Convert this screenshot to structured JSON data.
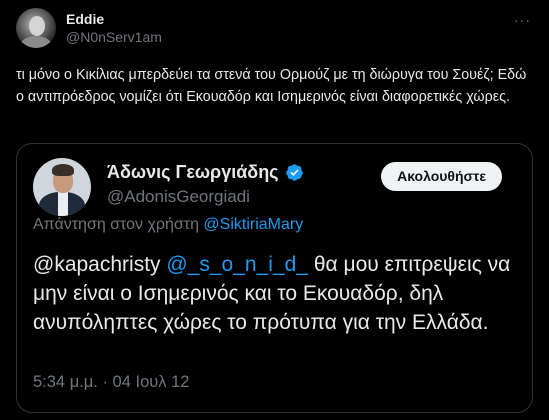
{
  "post": {
    "display_name": "Eddie",
    "handle": "@N0nServ1am",
    "more_label": "···",
    "text": "τι μόνο ο Κικίλιας μπερδεύει τα στενά του Ορμούζ με τη διώρυγα του Σουέζ; Εδώ ο αντιπρόεδρος νομίζει ότι Εκουαδόρ και Ισημερινός είναι διαφορετικές χώρες."
  },
  "quoted": {
    "display_name": "Άδωνις Γεωργιάδης",
    "handle": "@AdonisGeorgiadi",
    "verified": true,
    "follow_label": "Ακολουθήστε",
    "reply_prefix": "Απάντηση στον χρήστη ",
    "reply_mention": "@SiktiriaMary",
    "mention_1": "@kapachristy",
    "mention_2": "@_s_o_n_i_d_",
    "body_text": " θα μου επιτρεψεις να μην είναι ο Ισημερινός και το Εκουαδόρ, δηλ ανυπόληπτες χώρες το πρότυπα για την Ελλάδα.",
    "timestamp": "5:34 μ.μ. · 04 Ιουλ 12"
  },
  "colors": {
    "background": "#000000",
    "text": "#e7e9ea",
    "secondary": "#71767b",
    "accent": "#1d9bf0",
    "border": "#2f3336"
  }
}
